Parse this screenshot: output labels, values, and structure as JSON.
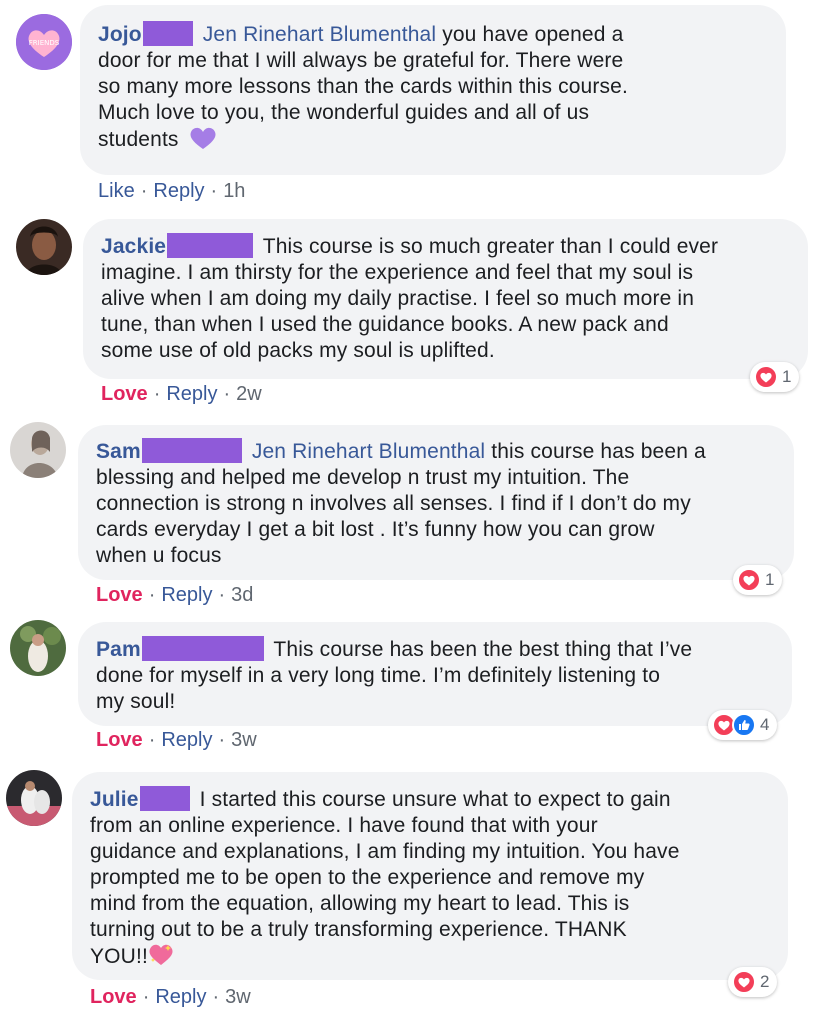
{
  "colors": {
    "name": "#385898",
    "love": "#e0245e",
    "bubble": "#f2f3f5",
    "redaction": "#8f5ad9",
    "meta": "#606770"
  },
  "comments": [
    {
      "author": "Jojo",
      "mention": "Jen Rinehart Blumenthal",
      "text_lines": [
        "you have opened a",
        "door for me that I will always be grateful for. There were",
        "so many more lessons than the cards within this course.",
        "Much love to you, the wonderful guides and all of us",
        "students"
      ],
      "reaction_label": "Like",
      "reply_label": "Reply",
      "time": "1h",
      "emoji": "purple-heart"
    },
    {
      "author": "Jackie",
      "text_lines": [
        "This course is so much greater than I could ever",
        "imagine. I am thirsty for the experience and feel that my soul is",
        "alive when I am doing my daily practise. I feel so much more in",
        "tune, than when I used the guidance books. A new pack and",
        "some use of old packs my soul is uplifted."
      ],
      "reaction_label": "Love",
      "reply_label": "Reply",
      "time": "2w",
      "reaction_count": "1"
    },
    {
      "author": "Sam",
      "mention": "Jen Rinehart Blumenthal",
      "text_lines": [
        "this course has been a",
        "blessing and helped me develop n trust my intuition. The",
        "connection is strong n involves all senses. I find if I don’t do my",
        "cards everyday I get a bit lost . It’s funny how you can grow",
        "when u focus"
      ],
      "reaction_label": "Love",
      "reply_label": "Reply",
      "time": "3d",
      "reaction_count": "1"
    },
    {
      "author": "Pam",
      "text_lines": [
        "This course has been the best thing that I’ve",
        "done for myself in a very long time. I’m definitely listening to",
        "my soul!"
      ],
      "reaction_label": "Love",
      "reply_label": "Reply",
      "time": "3w",
      "reaction_count": "4"
    },
    {
      "author": "Julie",
      "text_lines": [
        "I started this course unsure what to expect to gain",
        "from an online experience. I have found that with your",
        "guidance and explanations, I am finding my intuition. You have",
        "prompted me to be open to the experience and remove my",
        "mind from the equation, allowing my heart to lead. This is",
        "turning out to be a truly transforming experience. THANK",
        "YOU!!"
      ],
      "reaction_label": "Love",
      "reply_label": "Reply",
      "time": "3w",
      "reaction_count": "2",
      "emoji": "sparkling-heart"
    }
  ],
  "separator": "·",
  "avatar_badge_text": "FRIENDS"
}
